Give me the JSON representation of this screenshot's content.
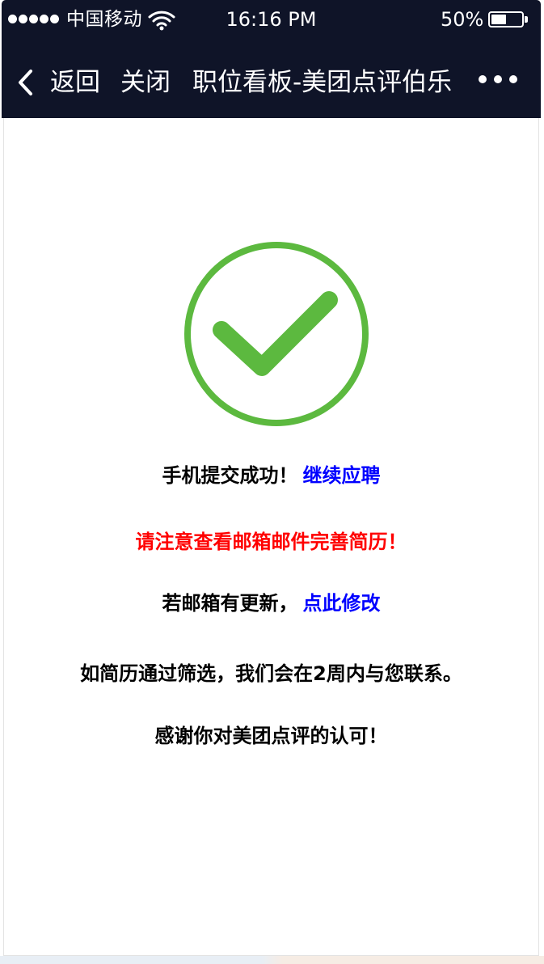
{
  "status_bar": {
    "carrier": "中国移动",
    "time": "16:16 PM",
    "battery_percent_label": "50%",
    "battery_level": 0.5,
    "signal_icon": "signal-dots-icon",
    "wifi_icon": "wifi-icon",
    "battery_icon": "battery-icon"
  },
  "nav": {
    "back_label": "返回",
    "close_label": "关闭",
    "title": "职位看板-美团点评伯乐",
    "back_icon": "chevron-left-icon",
    "more_icon": "more-dots-icon"
  },
  "result": {
    "icon": "check-circle-icon",
    "success_text": "手机提交成功！",
    "continue_link": "继续应聘",
    "email_notice": "请注意查看邮箱邮件完善简历！",
    "update_text": "若邮箱有更新，",
    "edit_link": "点此修改",
    "contact_text": "如简历通过筛选，我们会在2周内与您联系。",
    "thanks_text": "感谢你对美团点评的认可！"
  },
  "colors": {
    "header_bg": "#0f1428",
    "success_green": "#5cb93f",
    "link_blue": "#0000ff",
    "notice_red": "#ff0000"
  }
}
